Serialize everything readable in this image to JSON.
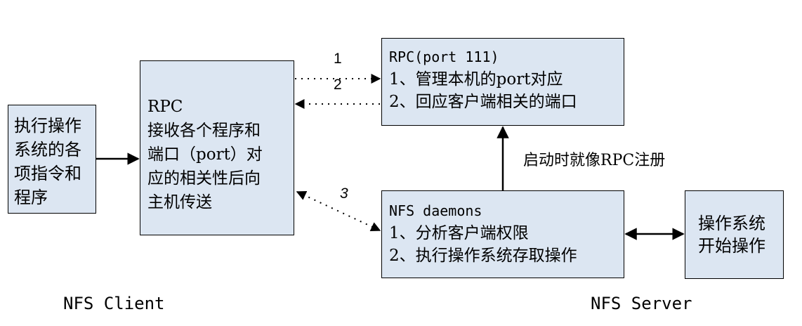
{
  "os_box": {
    "lines": [
      "执行操作",
      "系统的各",
      "项指令和",
      "程序"
    ]
  },
  "rpc_client_box": {
    "lines": [
      "RPC",
      "接收各个程序和",
      "端口（port）对",
      "应的相关性后向",
      "主机传送"
    ]
  },
  "rpc_server_box": {
    "lines": [
      "RPC(port 111)",
      "1、管理本机的port对应",
      "2、回应客户端相关的端口"
    ]
  },
  "nfs_daemons_box": {
    "lines": [
      "NFS daemons",
      "1、分析客户端权限",
      "2、执行操作系统存取操作"
    ]
  },
  "os_start_box": {
    "lines": [
      "操作系统",
      "开始操作"
    ]
  },
  "labels": {
    "register": "启动时就像RPC注册",
    "step1": "1",
    "step2": "2",
    "step3": "3"
  },
  "captions": {
    "client": "NFS Client",
    "server": "NFS Server"
  }
}
